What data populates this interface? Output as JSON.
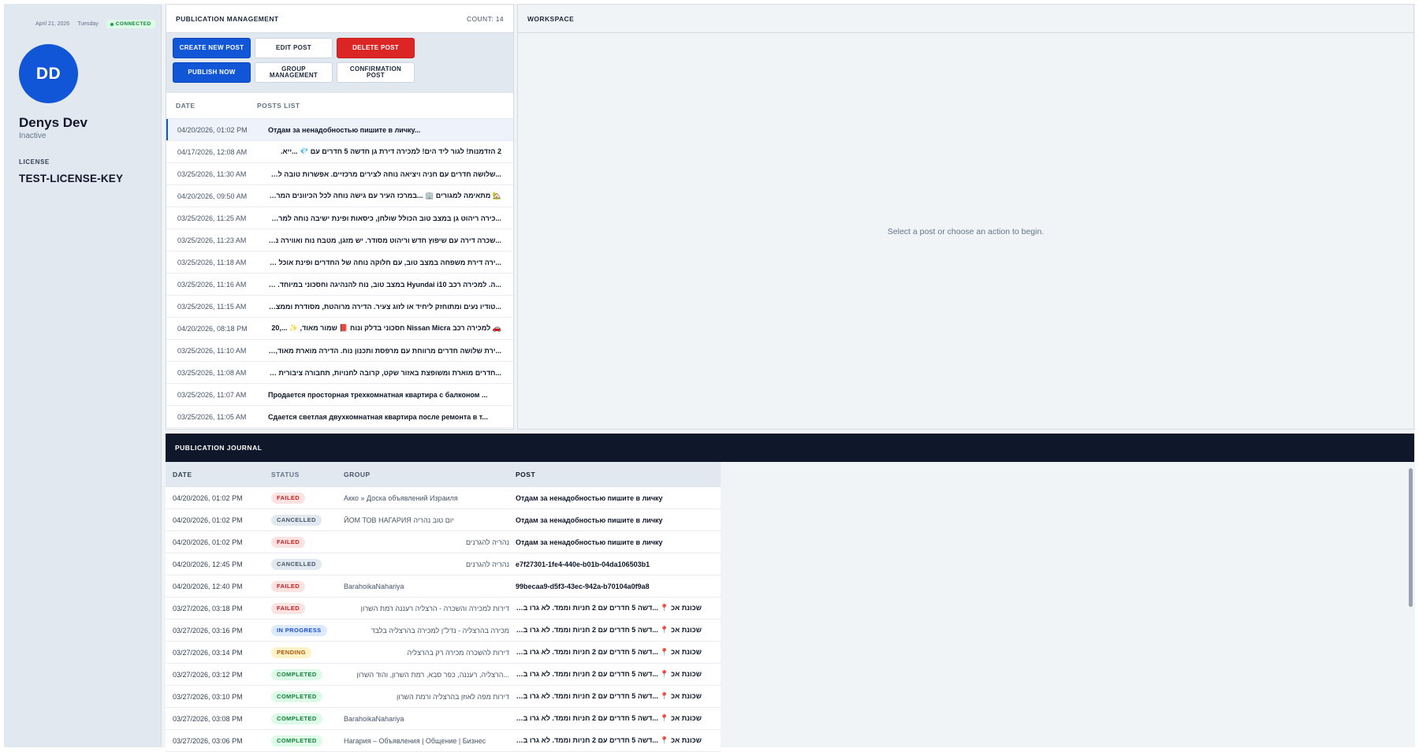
{
  "sidebar": {
    "date": "April 21, 2026",
    "weekday": "Tuesday",
    "connection": "CONNECTED",
    "avatar_initials": "DD",
    "user_name": "Denys Dev",
    "user_status": "Inactive",
    "license_label": "LICENSE",
    "license_key": "TEST-LICENSE-KEY"
  },
  "publication": {
    "title": "PUBLICATION MANAGEMENT",
    "count": "COUNT: 14",
    "buttons": {
      "create": "CREATE NEW POST",
      "edit": "EDIT POST",
      "delete": "DELETE POST",
      "publish": "PUBLISH NOW",
      "group": "GROUP MANAGEMENT",
      "confirm": "CONFIRMATION POST"
    },
    "columns": {
      "date": "DATE",
      "posts": "POSTS LIST"
    },
    "posts": [
      {
        "date": "04/20/2026, 01:02 PM",
        "text": "Отдам за ненадобностью пишите в личку..."
      },
      {
        "date": "04/17/2026, 12:08 AM",
        "text": "2 הזדמנות! לגור ליד הים! למכירה דירת גן חדשה 5 חדרים עם 💎 ...ייא."
      },
      {
        "date": "03/25/2026, 11:30 AM",
        "text": "...שלושה חדרים עם חניה ויציאה נוחה לצירים מרכזיים. אפשרות טובה למשפחה"
      },
      {
        "date": "04/20/2026, 09:50 AM",
        "text": "🏡 מתאימה למגורים 🏢 ...במרכז העיר עם גישה נוחה לכל הכיוונים המרכזיים."
      },
      {
        "date": "03/25/2026, 11:25 AM",
        "text": "...כירה ריהוט גן במצב טוב הכולל שולחן, כיסאות ופינת ישיבה נוחה למרפסת או"
      },
      {
        "date": "03/25/2026, 11:23 AM",
        "text": "...שכרה דירה עם שיפוץ חדש וריהוט מסודר. יש מזגן, מטבח נוח ואווירה נעימה"
      },
      {
        "date": "03/25/2026, 11:18 AM",
        "text": "...ירה דירת משפחה במצב טוב, עם חלוקה נוחה של החדרים ופינת אוכל מרווחת"
      },
      {
        "date": "03/25/2026, 11:16 AM",
        "text": "...ה. למכירה רכב Hyundai i10 במצב טוב, נוח להנהיגה וחסכוני במיוחד. הרכב"
      },
      {
        "date": "03/25/2026, 11:15 AM",
        "text": "...טודיו נעים ומתוחזק ליחיד או לזוג צעיר. הדירה מרוהטת, מסודרת וממצאת ליד"
      },
      {
        "date": "04/20/2026, 08:18 PM",
        "text": "🚗 למכירה רכב Nissan Micra חסכוני בדלק ונוח 📕 שמור מאוד, ✨ ...,20"
      },
      {
        "date": "03/25/2026, 11:10 AM",
        "text": "...ירת שלושה חדרים מרווחת עם מרפסת ותכנון נוח. הדירה מוארת מאוד, כוללת"
      },
      {
        "date": "03/25/2026, 11:08 AM",
        "text": "...חדרים מוארת ומשופצת באזור שקט, קרובה לחנויות, תחבורה ציבורית ויציאה"
      },
      {
        "date": "03/25/2026, 11:07 AM",
        "text": "Продается просторная трехкомнатная квартира с балконом ..."
      },
      {
        "date": "03/25/2026, 11:05 AM",
        "text": "Сдается светлая двухкомнатная квартира после ремонта в т..."
      }
    ]
  },
  "workspace": {
    "title": "WORKSPACE",
    "empty_message": "Select a post or choose an action to begin."
  },
  "journal": {
    "title": "PUBLICATION JOURNAL",
    "columns": {
      "date": "DATE",
      "status": "STATUS",
      "group": "GROUP",
      "post": "POST"
    },
    "rows": [
      {
        "date": "04/20/2026, 01:02 PM",
        "status": "FAILED",
        "kind": "failed",
        "group": "Акко » Доска объявлений Израиля",
        "post": "Отдам за ненадобностью пишите в личку"
      },
      {
        "date": "04/20/2026, 01:02 PM",
        "status": "CANCELLED",
        "kind": "cancelled",
        "group": "ЙОМ ТОВ НАГАРИЯ יום טוב נהריה",
        "post": "Отдам за ненадобностью пишите в личку"
      },
      {
        "date": "04/20/2026, 01:02 PM",
        "status": "FAILED",
        "kind": "failed",
        "group": "נהריה להגרנים",
        "post": "Отдам за ненадобностью пишите в личку"
      },
      {
        "date": "04/20/2026, 12:45 PM",
        "status": "CANCELLED",
        "kind": "cancelled",
        "group": "נהריה להגרנים",
        "post": "e7f27301-1fe4-440e-b01b-04da106503b1"
      },
      {
        "date": "04/20/2026, 12:40 PM",
        "status": "FAILED",
        "kind": "failed",
        "group": "BarahoikaNahariya",
        "post": "99becaa9-d5f3-43ec-942a-b70104a0f9a8"
      },
      {
        "date": "03/27/2026, 03:18 PM",
        "status": "FAILED",
        "kind": "failed",
        "group": "דירות למכירה והשכרה - הרצליה רעננה רמת השרון",
        "post": "שכונת אכ 📍 ...דשה 5 חדרים עם 2 חניות וממד. לא גרו בנכס."
      },
      {
        "date": "03/27/2026, 03:16 PM",
        "status": "IN PROGRESS",
        "kind": "progress",
        "group": "מכירה בהרצליה - נדל\"ן למכירה בהרצליה בלבד",
        "post": "שכונת אכ 📍 ...דשה 5 חדרים עם 2 חניות וממד. לא גרו בנכס."
      },
      {
        "date": "03/27/2026, 03:14 PM",
        "status": "PENDING",
        "kind": "pending",
        "group": "דירות להשכרה מכירה רק בהרצליה",
        "post": "שכונת אכ 📍 ...דשה 5 חדרים עם 2 חניות וממד. לא גרו בנכס."
      },
      {
        "date": "03/27/2026, 03:12 PM",
        "status": "COMPLETED",
        "kind": "completed",
        "group": "...הרצליה, רעננה, כפר סבא, רמת השרון, והוד השרון",
        "post": "שכונת אכ 📍 ...דשה 5 חדרים עם 2 חניות וממד. לא גרו בנכס."
      },
      {
        "date": "03/27/2026, 03:10 PM",
        "status": "COMPLETED",
        "kind": "completed",
        "group": "דירות מפה לאוזן בהרצליה ורמת השרון",
        "post": "שכונת אכ 📍 ...דשה 5 חדרים עם 2 חניות וממד. לא גרו בנכס."
      },
      {
        "date": "03/27/2026, 03:08 PM",
        "status": "COMPLETED",
        "kind": "completed",
        "group": "BarahoikaNahariya",
        "post": "שכונת אכ 📍 ...דשה 5 חדרים עם 2 חניות וממד. לא גרו בנכס."
      },
      {
        "date": "03/27/2026, 03:06 PM",
        "status": "COMPLETED",
        "kind": "completed",
        "group": "Нагария – Объявления | Общение | Бизнес",
        "post": "שכונת אכ 📍 ...דשה 5 חדרים עם 2 חניות וממד. לא גרו בנכס."
      }
    ]
  }
}
